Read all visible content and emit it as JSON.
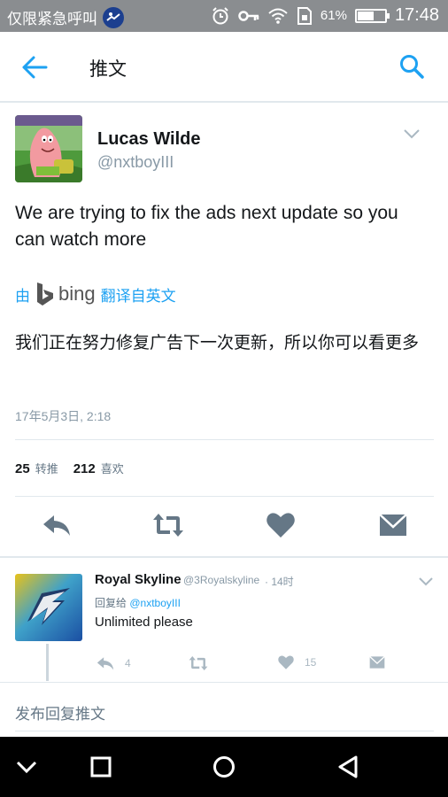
{
  "status_bar": {
    "carrier": "仅限紧急呼叫",
    "battery_percent": "61%",
    "battery_level": 0.61,
    "time": "17:48"
  },
  "header": {
    "title": "推文",
    "back_icon": "arrow-left-icon",
    "search_icon": "search-icon"
  },
  "tweet": {
    "author_name": "Lucas Wilde",
    "author_handle": "@nxtboyIII",
    "text": "We are trying to fix the ads next update so you can watch more",
    "translate_prefix": "由",
    "translate_brand": "bing",
    "translate_suffix": "翻译自英文",
    "translated_text": "我们正在努力修复广告下一次更新，所以你可以看更多",
    "timestamp": "17年5月3日, 2:18",
    "retweets": "25",
    "retweets_label": "转推",
    "likes": "212",
    "likes_label": "喜欢",
    "actions": [
      "reply-icon",
      "retweet-icon",
      "heart-icon",
      "direct-message-icon"
    ]
  },
  "reply": {
    "author_name": "Royal Skyline",
    "author_handle": "@3Royalskyline",
    "time": "· 14时",
    "reply_to_label": "回复给",
    "reply_to_handle": "@nxtboyIII",
    "text": "Unlimited please",
    "reply_count": "4",
    "retweet_count": "",
    "like_count": "15"
  },
  "compose": {
    "placeholder": "发布回复推文"
  },
  "colors": {
    "accent": "#1da1f2",
    "status_bar": "#8a8d90",
    "icon_gray": "#657786"
  }
}
